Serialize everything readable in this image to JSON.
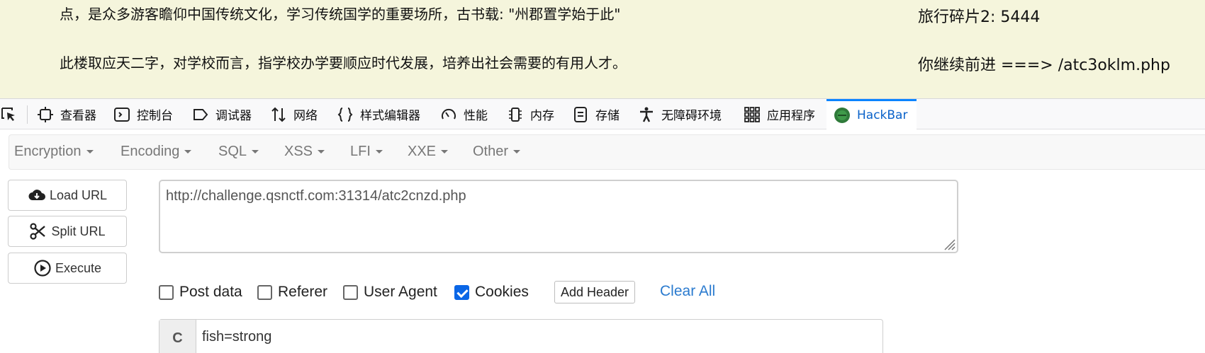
{
  "page": {
    "line1": "点，是众多游客瞻仰中国传统文化，学习传统国学的重要场所，古书载: \"州郡置学始于此\"",
    "line2": "此楼取应天二字，对学校而言，指学校办学要顺应时代发展，培养出社会需要的有用人才。",
    "fragment": "旅行碎片2: 5444",
    "next": "你继续前进 ===> /atc3oklm.php"
  },
  "devtools": {
    "tabs": [
      {
        "label": "查看器",
        "icon": "inspector-icon"
      },
      {
        "label": "控制台",
        "icon": "console-icon"
      },
      {
        "label": "调试器",
        "icon": "debugger-icon"
      },
      {
        "label": "网络",
        "icon": "network-icon"
      },
      {
        "label": "样式编辑器",
        "icon": "style-editor-icon"
      },
      {
        "label": "性能",
        "icon": "performance-icon"
      },
      {
        "label": "内存",
        "icon": "memory-icon"
      },
      {
        "label": "存储",
        "icon": "storage-icon"
      },
      {
        "label": "无障碍环境",
        "icon": "accessibility-icon"
      },
      {
        "label": "应用程序",
        "icon": "application-icon"
      },
      {
        "label": "HackBar",
        "icon": "hackbar-icon"
      }
    ],
    "active_tab": "HackBar",
    "accent": "#0a84ff"
  },
  "hackbar": {
    "menu": [
      "Encryption",
      "Encoding",
      "SQL",
      "XSS",
      "LFI",
      "XXE",
      "Other"
    ],
    "buttons": {
      "load": "Load URL",
      "split": "Split URL",
      "execute": "Execute"
    },
    "url": "http://challenge.qsnctf.com:31314/atc2cnzd.php",
    "options": {
      "post_data": {
        "label": "Post data",
        "checked": false
      },
      "referer": {
        "label": "Referer",
        "checked": false
      },
      "user_agent": {
        "label": "User Agent",
        "checked": false
      },
      "cookies": {
        "label": "Cookies",
        "checked": true
      }
    },
    "add_header": "Add Header",
    "clear_all": "Clear All",
    "cookie_prefix": "C",
    "cookie_value": "fish=strong",
    "checkbox_color": "#0a66e6",
    "link_color": "#2b7bcf"
  }
}
